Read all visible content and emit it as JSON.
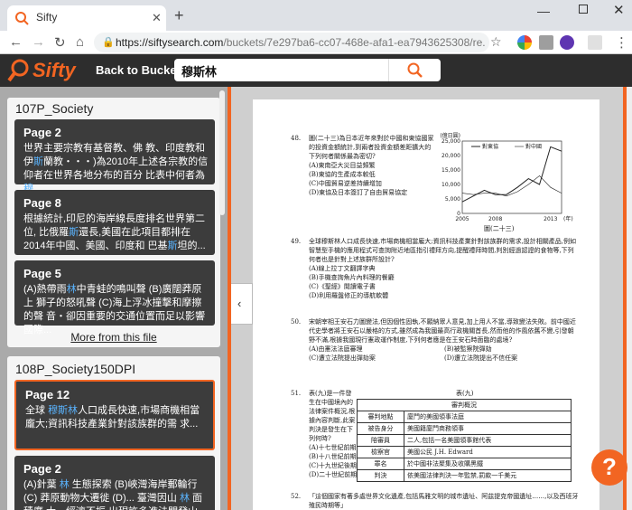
{
  "browser": {
    "tab_title": "Sifty",
    "new_tab": "+",
    "url_host": "https://siftysearch.com",
    "url_path": "/buckets/7e297ba6-cc07-468e-afa1-ea7943625308/re..."
  },
  "app": {
    "logo": "Sifty",
    "back_label": "Back to Bucket",
    "search_value": "穆斯林"
  },
  "results": {
    "sections": [
      {
        "title": "107P_Society",
        "cards": [
          {
            "title": "Page 2",
            "pre1": "世界主要宗教有基督教、佛 教、印度教和伊",
            "hl1": "斯",
            "mid1": "蘭教・・・)為2010年上述各宗教的信 仰者在世界各地分布的百分 比表中何者為",
            "hl2": "穆",
            "post": ""
          },
          {
            "title": "Page 8",
            "pre1": "根據統計,印尼的海岸線長度排名世界第二位, 比俄羅",
            "hl1": "斯",
            "mid1": "還長,美國在此項目都排在 2014年中國、美國、印度和 巴基",
            "hl2": "斯",
            "post": "坦的..."
          },
          {
            "title": "Page 5",
            "pre1": "(A)熱帶雨",
            "hl1": "林",
            "mid1": "中青蛙的鳴叫聲 (B)廣闊莽原上 獅子的怒吼聲 (C)海上浮冰撞擊和摩擦的聲 音・卻因重要的交通位置而足以影響國際...",
            "hl2": "",
            "post": ""
          }
        ],
        "more": "More from this file"
      },
      {
        "title": "108P_Society150DPI",
        "cards": [
          {
            "title": "Page 12",
            "pre1": "全球 ",
            "hl1": "穆斯林",
            "mid1": "人口成長快速,市場商機相當 龐大;資訊科技產業針對該族群的需 求...",
            "hl2": "",
            "post": ""
          },
          {
            "title": "Page 2",
            "pre1": "(A)針葉 ",
            "hl1": "林",
            "mid1": " 生態探索 (B)峽灣海岸郵輪行 (C) 莽原動物大遷徙 (D)... 臺灣因山 ",
            "hl2": "林",
            "post": " 面積廣 大・經濟不振,出現許多進法開發山"
          }
        ],
        "more": ""
      }
    ]
  },
  "document": {
    "q48": {
      "num": "48.",
      "text": "圖(二十三)為日本近年來對於中國和東協國家的投資金額統計,到兩者投資金額差距擴大的下列何者關係最為密切?",
      "options": [
        "(A)東南亞大災目益頻繁",
        "(B)東協的生產成本較低",
        "(C)中國貿易逆差持續增加",
        "(D)東協及日本簽訂了自由貿易協定"
      ],
      "chart_caption": "圖(二十三)"
    },
    "q49": {
      "num": "49.",
      "text": "全球穆斯林人口成長快速,市場商機相當龐大;資訊科技產業針對該族群的需求,設計相關產品,例如智慧型手機的應用程式可查詢附近地區指引禮拜方向,提醒禮拜時間,判別經過認證的食物等,下列何者也是針對上述族群所設計?",
      "options": [
        "(A)線上拉丁文翻譯字典",
        "(B)手機查詢魚片內料理的餐廳",
        "(C)《聖經》閱讀電子書",
        "(D)利用羅盤修正的導航軟體"
      ]
    },
    "q50": {
      "num": "50.",
      "text": "宋朝宰相王安石力圖變法,但因個性固執,不願納眾人意見,加上用人不當,導致變法失敗。前中國近代史學者將王安石以嚴格的方式,雖然成為我國最高行政機關首長,然而他的作風依舊不變,引發朝野不滿,根據我國現行憲政運作制度,下列何者應是在王安石時面臨的處境?",
      "options": [
        "(A)由憲法法庭審理",
        "(B)被監察院彈劾",
        "(C)遭立法院提出彈劾案",
        "(D)遭立法院提出不信任案"
      ]
    },
    "q51": {
      "num": "51.",
      "text": "表(九)是一件發生在中國境內的法律案件概況,根據內容判斷,此案判決是發生在下列何時?",
      "options": [
        "(A)十七世紀前期",
        "(B)十八世紀前期",
        "(C)十九世紀後期",
        "(D)二十世紀前期"
      ],
      "table_caption": "表(九)",
      "table_header": "審判概況",
      "table_rows": [
        [
          "審判地點",
          "廈門的美國領事法庭"
        ],
        [
          "被告身分",
          "美國籍廈門商務領事"
        ],
        [
          "陪審員",
          "二人,包括一名美國領事館代表"
        ],
        [
          "檢察官",
          "美國公民 J.H. Edward"
        ],
        [
          "罪名",
          "於中國非法聚集及收購黑鐵"
        ],
        [
          "判決",
          "依美國法律判決一年監禁,罰款一千美元"
        ]
      ]
    },
    "q52": {
      "num": "52.",
      "text": "「這個國家有著多處世界文化遺產,包括馬雅文明的城市遺址、阿茲提克帝國遺址……,以及西班牙殖民時期等」"
    }
  },
  "chart_data": {
    "type": "line",
    "title": "",
    "ylabel": "(億日圓)",
    "xlabel": "(年)",
    "x_ticks": [
      "2005",
      "2008",
      "2013"
    ],
    "y_ticks": [
      "0",
      "5,000",
      "10,000",
      "15,000",
      "20,000",
      "25,000"
    ],
    "ylim": [
      0,
      25000
    ],
    "x": [
      2005,
      2006,
      2007,
      2008,
      2009,
      2010,
      2011,
      2012,
      2013,
      2014
    ],
    "series": [
      {
        "name": "對東協",
        "values": [
          4000,
          6000,
          8000,
          6500,
          6500,
          9000,
          12000,
          10000,
          23000,
          21500
        ]
      },
      {
        "name": "對中國",
        "values": [
          7000,
          6500,
          7000,
          7000,
          6000,
          7500,
          10000,
          13000,
          9000,
          7000
        ]
      }
    ]
  },
  "help_label": "?"
}
